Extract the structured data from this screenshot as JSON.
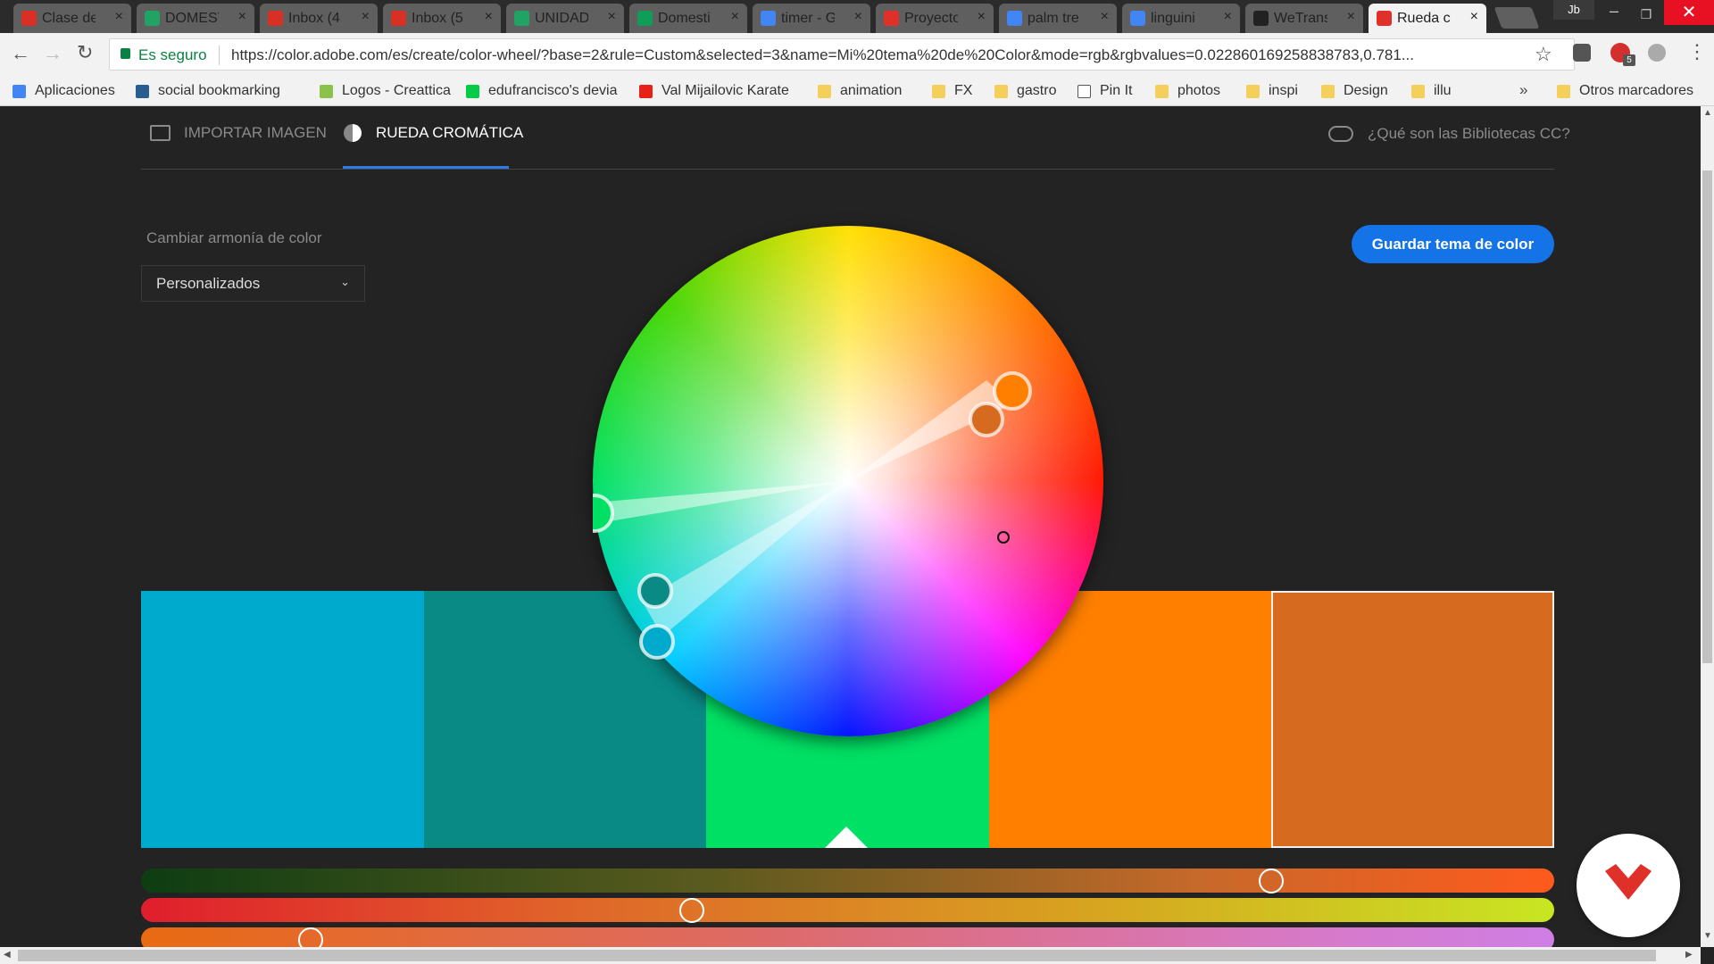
{
  "browser": {
    "tabs": [
      {
        "title": "Clase de",
        "icon": "gmail-icon",
        "color": "#d93025"
      },
      {
        "title": "DOMEST",
        "icon": "drive-icon",
        "color": "#1fa463"
      },
      {
        "title": "Inbox (4",
        "icon": "gmail-icon",
        "color": "#d93025"
      },
      {
        "title": "Inbox (5",
        "icon": "gmail-icon",
        "color": "#d93025"
      },
      {
        "title": "UNIDAD",
        "icon": "drive-icon",
        "color": "#1fa463"
      },
      {
        "title": "Domesti",
        "icon": "sheets-icon",
        "color": "#0f9d58"
      },
      {
        "title": "timer - G",
        "icon": "google-icon",
        "color": "#4285f4"
      },
      {
        "title": "Proyecto",
        "icon": "domestika-icon",
        "color": "#e0302a"
      },
      {
        "title": "palm tre",
        "icon": "google-icon",
        "color": "#4285f4"
      },
      {
        "title": "linguini",
        "icon": "google-icon",
        "color": "#4285f4"
      },
      {
        "title": "WeTrans",
        "icon": "wetransfer-icon",
        "color": "#222222"
      },
      {
        "title": "Rueda c",
        "icon": "adobe-icon",
        "color": "#e0302a"
      }
    ],
    "profile": "Jb",
    "secure_label": "Es seguro",
    "url": "https://color.adobe.com/es/create/color-wheel/?base=2&rule=Custom&selected=3&name=Mi%20tema%20de%20Color&mode=rgb&rgbvalues=0.022860169258838783,0.781...",
    "extension_badge": "5",
    "bookmarks": [
      {
        "label": "Aplicaciones",
        "icon": "apps-icon"
      },
      {
        "label": "social bookmarking",
        "icon": "site-icon"
      },
      {
        "label": "Logos - Creattica",
        "icon": "leaf-icon"
      },
      {
        "label": "edufrancisco's devia",
        "icon": "deviantart-icon"
      },
      {
        "label": "Val Mijailovic Karate",
        "icon": "youtube-icon"
      },
      {
        "label": "animation",
        "icon": "folder-icon"
      },
      {
        "label": "FX",
        "icon": "folder-icon"
      },
      {
        "label": "gastro",
        "icon": "folder-icon"
      },
      {
        "label": "Pin It",
        "icon": "page-icon"
      },
      {
        "label": "photos",
        "icon": "folder-icon"
      },
      {
        "label": "inspi",
        "icon": "folder-icon"
      },
      {
        "label": "Design",
        "icon": "folder-icon"
      },
      {
        "label": "illu",
        "icon": "folder-icon"
      }
    ],
    "more_bookmarks": "»",
    "other_bookmarks": "Otros marcadores"
  },
  "app": {
    "nav": {
      "import_label": "IMPORTAR IMAGEN",
      "wheel_label": "RUEDA CROMÁTICA",
      "libraries_label": "¿Qué son las Bibliotecas CC?"
    },
    "harmony": {
      "label": "Cambiar armonía de color",
      "selected": "Personalizados"
    },
    "save_button": "Guardar tema de color",
    "swatches": [
      "#00aacc",
      "#098a85",
      "#00e064",
      "#ff7f00",
      "#d66b1f"
    ],
    "selected_swatch": 2,
    "sliders": [
      {
        "gradient": "linear-gradient(90deg,#0d3d12,#5a5a1e 40%,#c7692a 75%,#ff5a1d)",
        "value": 0.8
      },
      {
        "gradient": "linear-gradient(90deg,#e01e2c,#e0642a 30%,#d8a020 65%,#c8e622)",
        "value": 0.39
      },
      {
        "gradient": "linear-gradient(90deg,#e86a12,#dd6a6a 45%,#d878c2 80%,#cf7ee6)",
        "value": 0.12
      }
    ]
  }
}
